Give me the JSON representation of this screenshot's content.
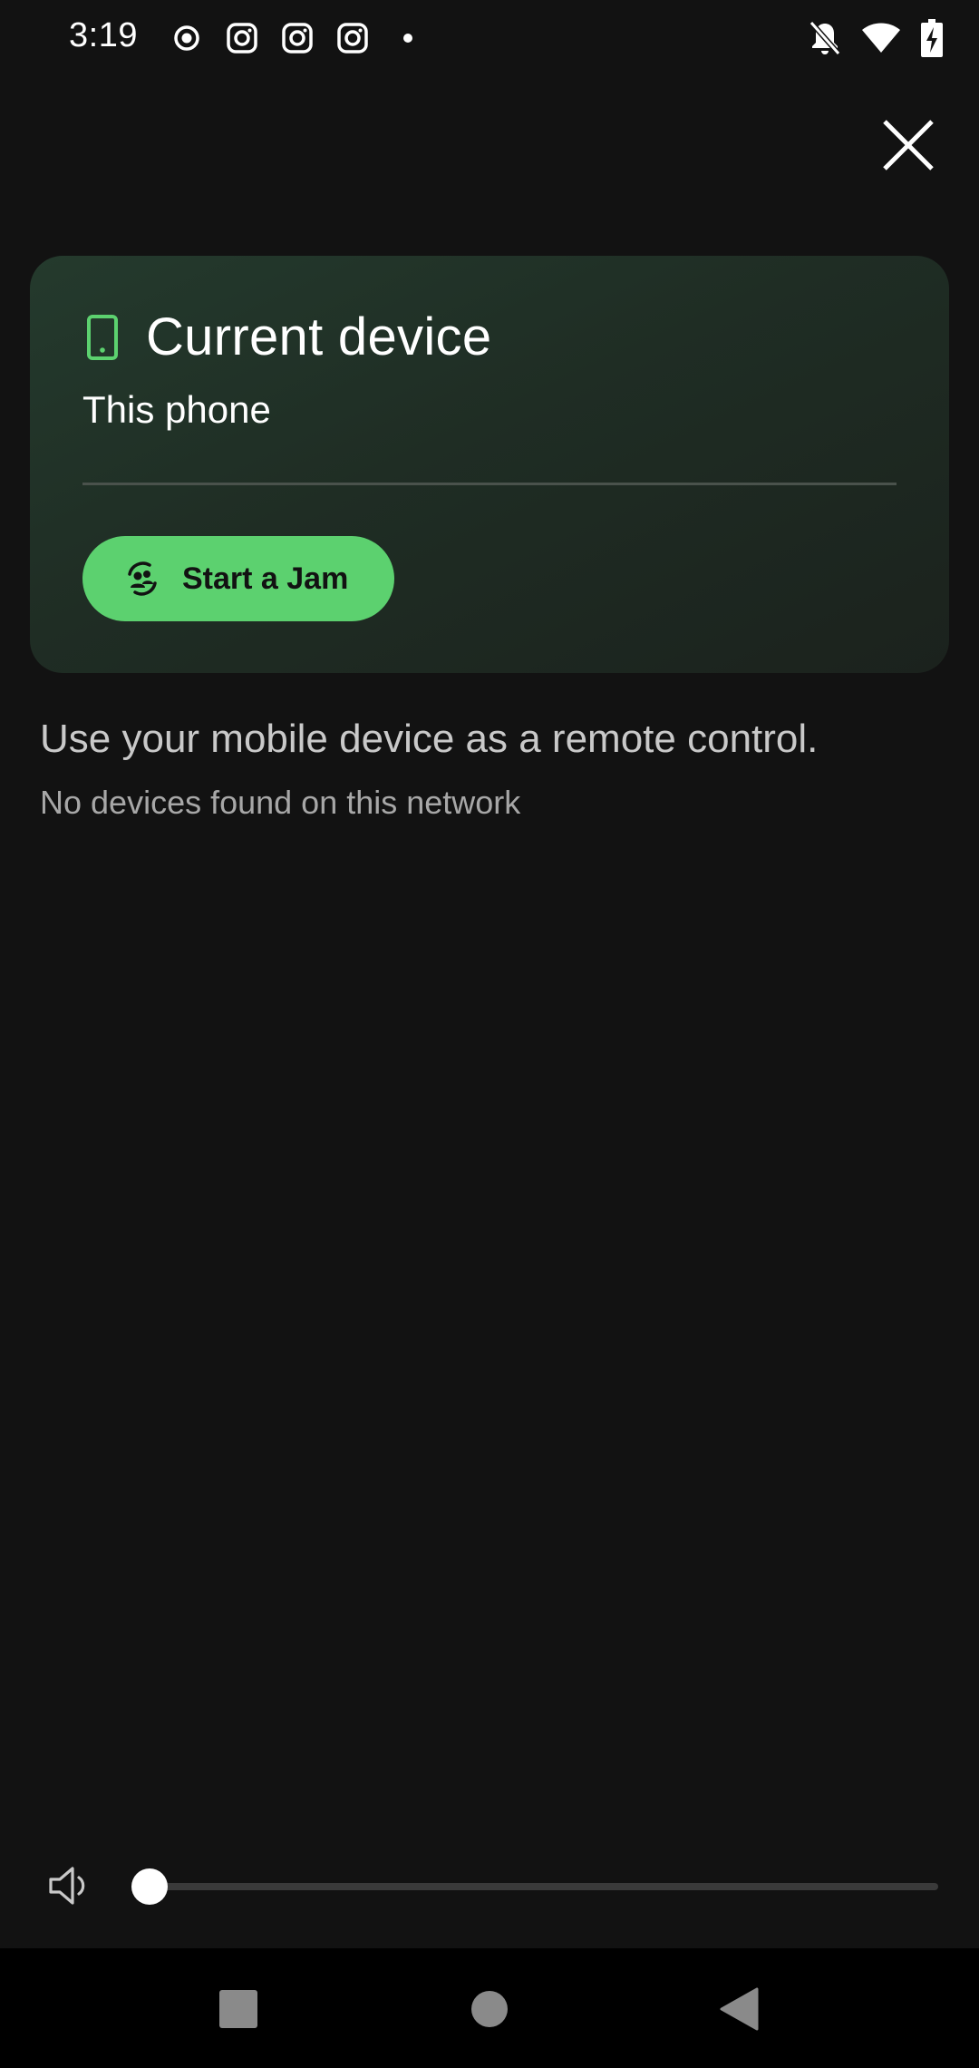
{
  "status_bar": {
    "time": "3:19",
    "icons_left": [
      "record-icon",
      "instagram-icon",
      "instagram-icon",
      "instagram-icon",
      "dot-icon"
    ],
    "icons_right": [
      "notifications-off-icon",
      "wifi-icon",
      "battery-charging-icon"
    ]
  },
  "close": {
    "icon": "close-icon"
  },
  "device_card": {
    "icon": "smartphone-icon",
    "title": "Current device",
    "subtitle": "This phone",
    "jam_button": {
      "icon": "jam-icon",
      "label": "Start a Jam"
    }
  },
  "info": {
    "primary": "Use your mobile device as a remote control.",
    "secondary": "No devices found on this network"
  },
  "volume": {
    "icon": "volume-icon",
    "level": 0
  },
  "nav_bar": {
    "buttons": [
      "recents-icon",
      "home-icon",
      "back-icon"
    ]
  },
  "colors": {
    "background": "#121212",
    "accent": "#5cd16f",
    "card": "#1f2d24"
  }
}
